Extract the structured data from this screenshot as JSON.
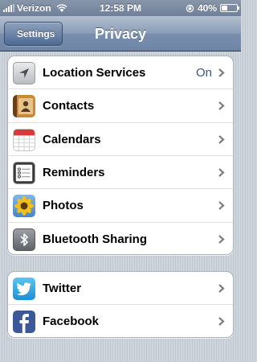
{
  "status_bar": {
    "carrier": "Verizon",
    "time": "12:58 PM",
    "battery": "40%",
    "battery_level": 0.4
  },
  "nav": {
    "back_label": "Settings",
    "title": "Privacy"
  },
  "group1": [
    {
      "label": "Location Services",
      "value": "On",
      "icon": "location-arrow-icon"
    },
    {
      "label": "Contacts",
      "icon": "contacts-book-icon"
    },
    {
      "label": "Calendars",
      "icon": "calendar-icon"
    },
    {
      "label": "Reminders",
      "icon": "reminders-list-icon"
    },
    {
      "label": "Photos",
      "icon": "sunflower-photos-icon"
    },
    {
      "label": "Bluetooth Sharing",
      "icon": "bluetooth-icon"
    }
  ],
  "group2": [
    {
      "label": "Twitter",
      "icon": "twitter-bird-icon"
    },
    {
      "label": "Facebook",
      "icon": "facebook-f-icon"
    }
  ],
  "colors": {
    "value_blue": "#385487",
    "twitter_blue": "#2da8e1",
    "facebook_blue": "#3b5998"
  }
}
